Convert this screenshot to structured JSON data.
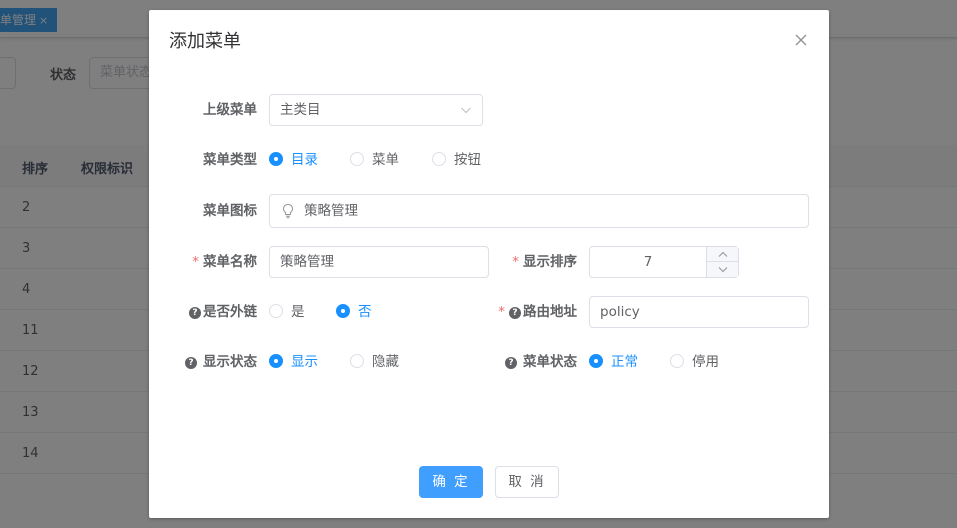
{
  "background": {
    "active_tag": "单管理",
    "tag_close": "×",
    "search_label": "状态",
    "search_placeholder": "菜单状态",
    "table_headers": [
      "排序",
      "权限标识"
    ],
    "table_rows": [
      "2",
      "3",
      "4",
      "11",
      "12",
      "13",
      "14"
    ]
  },
  "dialog": {
    "title": "添加菜单",
    "fields": {
      "parent_menu": {
        "label": "上级菜单",
        "value": "主类目"
      },
      "menu_type": {
        "label": "菜单类型",
        "options": [
          "目录",
          "菜单",
          "按钮"
        ],
        "selected": "目录"
      },
      "menu_icon": {
        "label": "菜单图标",
        "value": "策略管理",
        "icon": "lightbulb-icon"
      },
      "menu_name": {
        "label": "菜单名称",
        "required_mark": "*",
        "value": "策略管理"
      },
      "display_order": {
        "label": "显示排序",
        "required_mark": "*",
        "value": "7"
      },
      "external_link": {
        "label": "是否外链",
        "help": "?",
        "options": [
          "是",
          "否"
        ],
        "selected": "否"
      },
      "route_path": {
        "label": "路由地址",
        "required_mark": "*",
        "help": "?",
        "value": "policy"
      },
      "visible_status": {
        "label": "显示状态",
        "help": "?",
        "options": [
          "显示",
          "隐藏"
        ],
        "selected": "显示"
      },
      "menu_status": {
        "label": "菜单状态",
        "help": "?",
        "options": [
          "正常",
          "停用"
        ],
        "selected": "正常"
      }
    },
    "buttons": {
      "confirm": "确 定",
      "cancel": "取 消"
    }
  },
  "colors": {
    "primary": "#409eff",
    "radio_active": "#1890ff",
    "required": "#f56c6c",
    "tag_active": "#42a5f5"
  }
}
